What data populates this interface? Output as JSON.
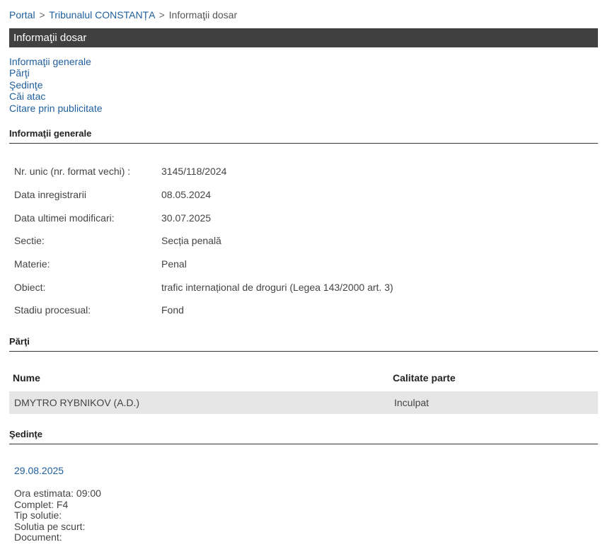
{
  "breadcrumb": {
    "portal": "Portal",
    "court": "Tribunalul CONSTANȚA",
    "current": "Informaţii dosar",
    "separator": ">"
  },
  "title_bar": {
    "title": "Informaţii dosar"
  },
  "quick_nav": {
    "items": [
      "Informaţii generale",
      "Părţi",
      "Şedinţe",
      "Căi atac",
      "Citare prin publicitate"
    ]
  },
  "general_info": {
    "heading": "Informaţii generale",
    "rows": [
      {
        "label": "Nr. unic (nr. format vechi) :",
        "value": "3145/118/2024"
      },
      {
        "label": "Data inregistrarii",
        "value": "08.05.2024"
      },
      {
        "label": "Data ultimei modificari:",
        "value": "30.07.2025"
      },
      {
        "label": "Sectie:",
        "value": "Secția penală"
      },
      {
        "label": "Materie:",
        "value": "Penal"
      },
      {
        "label": "Obiect:",
        "value": "trafic internațional de droguri (Legea 143/2000 art. 3)"
      },
      {
        "label": "Stadiu procesual:",
        "value": "Fond"
      }
    ]
  },
  "parties": {
    "heading": "Părţi",
    "columns": [
      "Nume",
      "Calitate parte"
    ],
    "rows": [
      {
        "name": "DMYTRO RYBNIKOV (A.D.)",
        "role": "Inculpat"
      }
    ]
  },
  "hearings": {
    "heading": "Şedinţe",
    "date": "29.08.2025",
    "lines": [
      "Ora estimata: 09:00",
      "Complet: F4",
      "Tip solutie:",
      "Solutia pe scurt:",
      "Document:"
    ]
  },
  "colors": {
    "link": "#1f5f9e",
    "title_bar_bg": "#404040",
    "row_bg": "#e6e6e6"
  }
}
